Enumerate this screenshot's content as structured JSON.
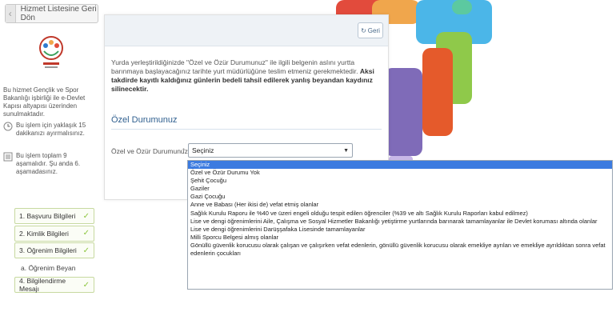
{
  "back_button": {
    "label": "Hizmet Listesine Geri Dön"
  },
  "sidebar": {
    "description": "Bu hizmet Gençlik ve Spor Bakanlığı işbirliği ile e-Devlet Kapısı altyapısı üzerinden sunulmaktadır.",
    "time_info": "Bu işlem için yaklaşık 15 dakikanızı ayırmalısınız.",
    "stage_info": "Bu işlem toplam 9 aşamalıdır. Şu anda 6. aşamadasınız.",
    "steps": [
      {
        "label": "1. Başvuru Bilgileri"
      },
      {
        "label": "2. Kimlik Bilgileri"
      },
      {
        "label": "3. Öğrenim Bilgileri"
      },
      {
        "label": "a. Öğrenim Beyan"
      },
      {
        "label": "4. Bilgilendirme Mesajı"
      }
    ]
  },
  "panel": {
    "geri_label": "Geri",
    "warning_normal": "Yurda yerleştirildiğinizde \"Özel ve Özür Durumunuz\" ile ilgili belgenin aslını yurtta barınmaya başlayacağınız tarihte yurt müdürlüğüne teslim etmeniz gerekmektedir.",
    "warning_bold": "Aksi takdirde kayıtlı kaldığınız günlerin bedeli tahsil edilerek yanlış beyandan kaydınız silinecektir.",
    "section_title": "Özel Durumunuz",
    "field_label": "Özel ve Özür Durumunuz",
    "required_mark": "*",
    "select_value": "Seçiniz"
  },
  "dropdown": {
    "options": [
      "Seçiniz",
      "Özel ve Özür Durumu Yok",
      "Şehit Çocuğu",
      "Gaziler",
      "Gazi Çocuğu",
      "Anne ve Babası (Her ikisi de) vefat etmiş olanlar",
      "Sağlık Kurulu Raporu ile %40 ve üzeri engeli olduğu tespit edilen öğrenciler (%39 ve altı Sağlık Kurulu Raporları kabul edilmez)",
      "Lise ve dengi öğrenimlerini Aile, Çalışma ve Sosyal Hizmetler Bakanlığı yetiştirme yurtlarında barınarak tamamlayanlar ile Devlet koruması altında olanlar",
      "Lise ve dengi öğrenimlerini Darüşşafaka Lisesinde tamamlayanlar",
      "Milli Sporcu Belgesi almış olanlar",
      "Gönüllü güvenlik korucusu olarak çalışan ve çalışırken vefat edenlerin, gönüllü güvenlik korucusu olarak emekliye ayrılan ve emekliye ayrıldıktan sonra vefat edenlerin çocukları"
    ],
    "selected_index": 0
  },
  "colors": {
    "accent": "#2f5f8f",
    "selected": "#3c7be0",
    "step_check": "#8dc63f"
  }
}
